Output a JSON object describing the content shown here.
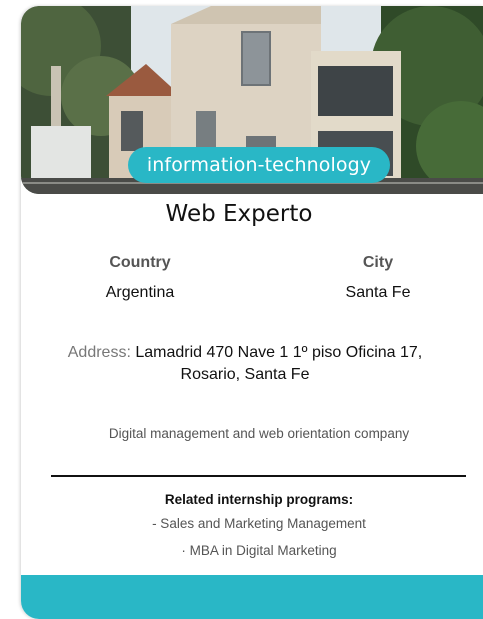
{
  "company": {
    "category": "information-technology",
    "name": "Web Experto",
    "country_label": "Country",
    "country": "Argentina",
    "city_label": "City",
    "city": "Santa Fe",
    "address_label": "Address:",
    "address": "Lamadrid 470 Nave 1 1º piso Oficina 17, Rosario, Santa Fe",
    "description": "Digital management and web orientation company"
  },
  "programs": {
    "title": "Related internship programs:",
    "items": [
      "- Sales and Marketing Management",
      "· MBA in Digital Marketing"
    ]
  },
  "colors": {
    "accent": "#29b7c6",
    "text": "#111111",
    "muted": "#555555"
  }
}
